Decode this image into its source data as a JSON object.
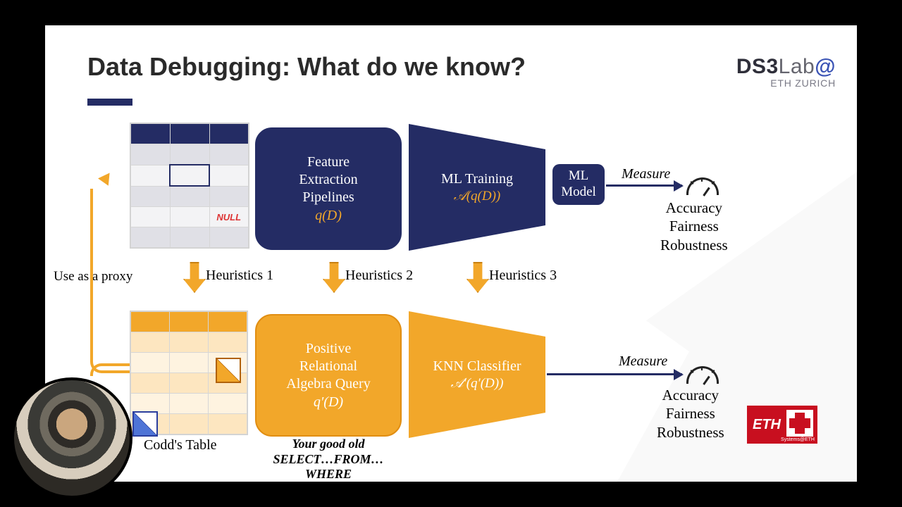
{
  "title": "Data Debugging: What do we know?",
  "logo": {
    "name": "DS3",
    "suffix": "Lab",
    "at": "@",
    "sub": "ETH ZURICH"
  },
  "nullcell": "NULL",
  "fe_box": {
    "l1": "Feature",
    "l2": "Extraction",
    "l3": "Pipelines",
    "formula": "q(D)"
  },
  "train_funnel": {
    "l1": "ML Training",
    "formula": "𝒜(q(D))"
  },
  "ml_box": {
    "l1": "ML",
    "l2": "Model"
  },
  "pra_box": {
    "l1": "Positive",
    "l2": "Relational",
    "l3": "Algebra Query",
    "formula": "q′(D)"
  },
  "knn_funnel": {
    "l1": "KNN Classifier",
    "formula": "𝒜′(q′(D))"
  },
  "measure": "Measure",
  "metrics": {
    "m1": "Accuracy",
    "m2": "Fairness",
    "m3": "Robustness"
  },
  "heuristics": {
    "h1": "Heuristics 1",
    "h2": "Heuristics 2",
    "h3": "Heuristics 3"
  },
  "proxy_label": "Use as a proxy",
  "codd_caption": "Codd's Table",
  "sql_caption": {
    "l1": "Your good old",
    "l2": "SELECT…FROM…",
    "l3": "WHERE"
  },
  "eth_text": "ETH",
  "eth_sub": "Systems@ETH"
}
